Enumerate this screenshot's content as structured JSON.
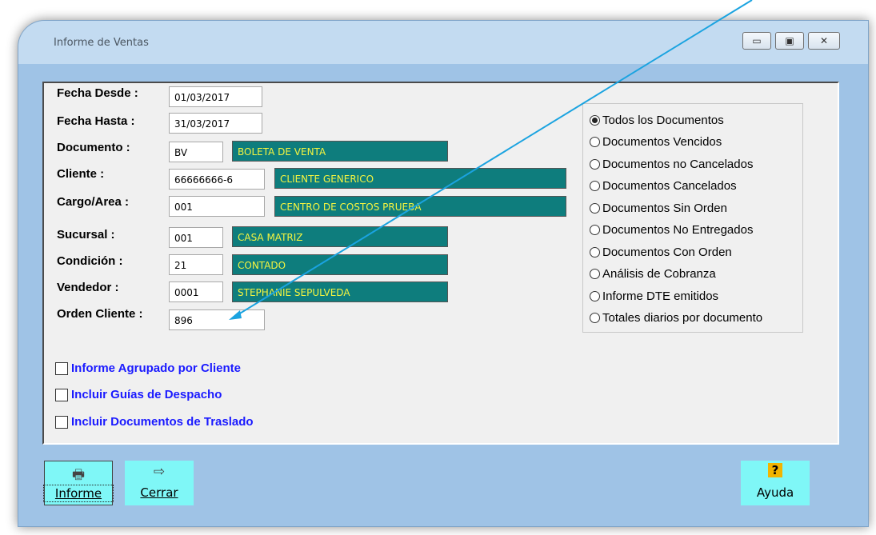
{
  "window": {
    "title": "Informe de Ventas",
    "controls": {
      "minimize": "▭",
      "maximize": "▣",
      "close": "✕"
    }
  },
  "form": {
    "fecha_desde": {
      "label": "Fecha Desde :",
      "value": "01/03/2017"
    },
    "fecha_hasta": {
      "label": "Fecha Hasta :",
      "value": "31/03/2017"
    },
    "documento": {
      "label": "Documento :",
      "value": "BV",
      "description": "BOLETA DE VENTA"
    },
    "cliente": {
      "label": "Cliente :",
      "value": "66666666-6",
      "description": "CLIENTE GENERICO"
    },
    "cargo_area": {
      "label": "Cargo/Area :",
      "value": "001",
      "description": "CENTRO DE COSTOS PRUEBA"
    },
    "sucursal": {
      "label": "Sucursal :",
      "value": "001",
      "description": "CASA MATRIZ"
    },
    "condicion": {
      "label": "Condición :",
      "value": "21",
      "description": "CONTADO"
    },
    "vendedor": {
      "label": "Vendedor :",
      "value": "0001",
      "description": "STEPHANIE SEPULVEDA"
    },
    "orden_cliente": {
      "label": "Orden Cliente :",
      "value": "896"
    }
  },
  "options": [
    {
      "label": "Todos los Documentos",
      "checked": true
    },
    {
      "label": "Documentos Vencidos",
      "checked": false
    },
    {
      "label": "Documentos no Cancelados",
      "checked": false
    },
    {
      "label": "Documentos Cancelados",
      "checked": false
    },
    {
      "label": "Documentos Sin Orden",
      "checked": false
    },
    {
      "label": "Documentos No Entregados",
      "checked": false
    },
    {
      "label": "Documentos Con Orden",
      "checked": false
    },
    {
      "label": "Análisis de Cobranza",
      "checked": false
    },
    {
      "label": "Informe DTE emitidos",
      "checked": false
    },
    {
      "label": "Totales diarios por documento",
      "checked": false
    }
  ],
  "checkboxes": [
    {
      "label": "Informe Agrupado por Cliente",
      "checked": false
    },
    {
      "label": "Incluir Guías de Despacho",
      "checked": false
    },
    {
      "label": "Incluir Documentos de Traslado",
      "checked": false
    }
  ],
  "toolbar": {
    "informe_label": "Informe",
    "cerrar_label": "Cerrar",
    "ayuda_label": "Ayuda",
    "ayuda_icon_text": "?"
  },
  "colors": {
    "window_bg": "#9fc3e6",
    "desc_bg": "#0e7d7d",
    "desc_text": "#f4f440",
    "button_bg": "#7ff7f7",
    "checkbox_text": "#1a1aff",
    "annotation_arrow": "#1aa3e0"
  }
}
